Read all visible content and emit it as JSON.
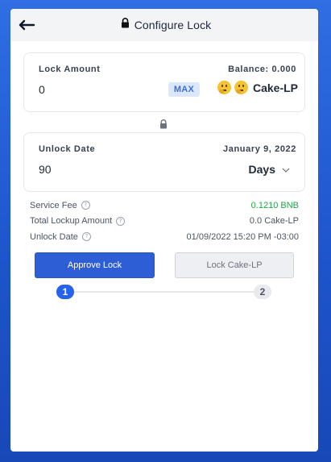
{
  "header": {
    "title": "Configure Lock"
  },
  "lock_amount": {
    "label": "Lock Amount",
    "balance": "Balance: 0.000",
    "value": "0",
    "max_label": "MAX",
    "token": "Cake-LP"
  },
  "unlock_date": {
    "label": "Unlock Date",
    "date": "January 9, 2022",
    "value": "90",
    "unit": "Days"
  },
  "info": {
    "service_fee_label": "Service Fee",
    "service_fee_value": "0.1210 BNB",
    "total_lockup_label": "Total Lockup Amount",
    "total_lockup_value": "0.0 Cake-LP",
    "unlock_date_label": "Unlock Date",
    "unlock_date_value": "01/09/2022 15:20 PM -03:00"
  },
  "buttons": {
    "approve": "Approve Lock",
    "lock": "Lock Cake-LP"
  },
  "steps": [
    "1",
    "2"
  ],
  "colors": {
    "primary": "#2d5ed6",
    "fee_green": "#22a34a"
  }
}
